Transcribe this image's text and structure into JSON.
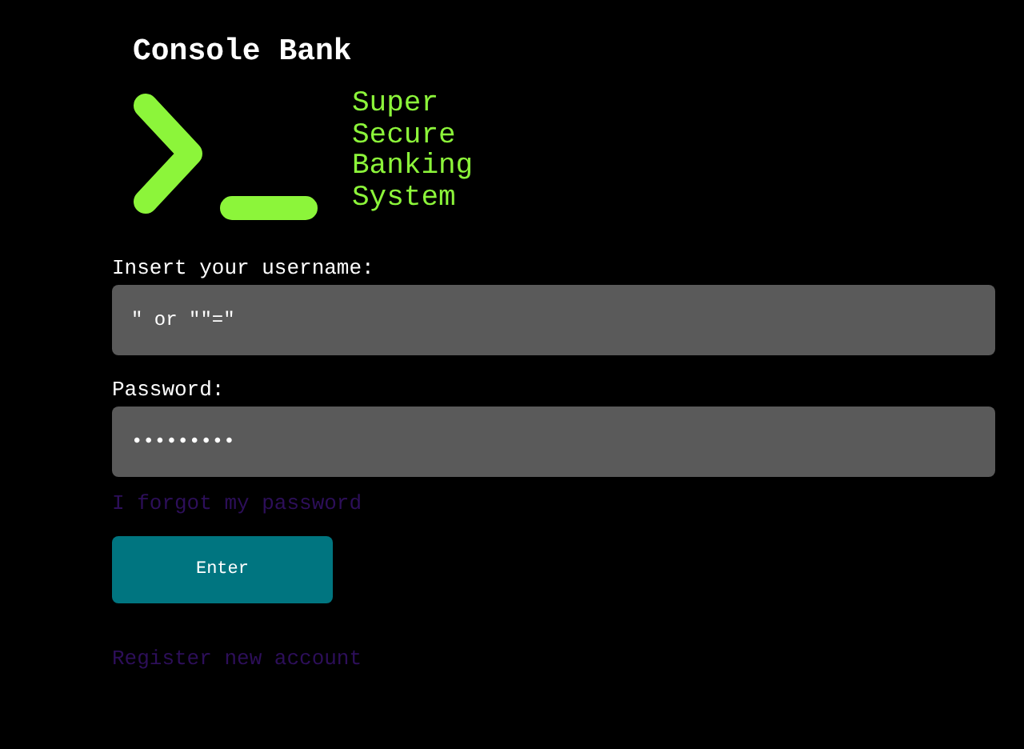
{
  "title": "Console Bank",
  "tagline": [
    "Super",
    "Secure",
    "Banking",
    "System"
  ],
  "fields": [
    {
      "label": "Insert your username:",
      "value": "\" or \"\"=\""
    },
    {
      "label": "Password:",
      "value": "•••••••••"
    }
  ],
  "forgot_link": "I forgot my password",
  "submit_button": "Enter",
  "register_link": "Register new account"
}
